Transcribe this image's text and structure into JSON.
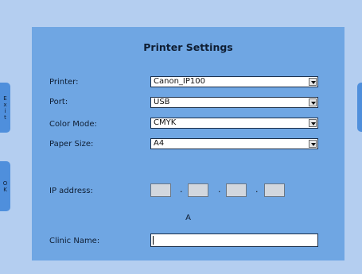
{
  "title": "Printer Settings",
  "side_buttons": {
    "exit": "E\nx\ni\nt",
    "ok": "O\nK"
  },
  "fields": {
    "printer": {
      "label": "Printer:",
      "value": "Canon_IP100"
    },
    "port": {
      "label": "Port:",
      "value": "USB"
    },
    "color_mode": {
      "label": "Color Mode:",
      "value": "CMYK"
    },
    "paper_size": {
      "label": "Paper Size:",
      "value": "A4"
    }
  },
  "ip": {
    "label": "IP address:",
    "octets": [
      "",
      "",
      "",
      ""
    ],
    "separator": "."
  },
  "ip_status": "A",
  "clinic": {
    "label": "Clinic Name:",
    "value": ""
  },
  "colors": {
    "background": "#b4cef0",
    "panel": "#6fa6e3",
    "side_button": "#4f8fdc"
  }
}
